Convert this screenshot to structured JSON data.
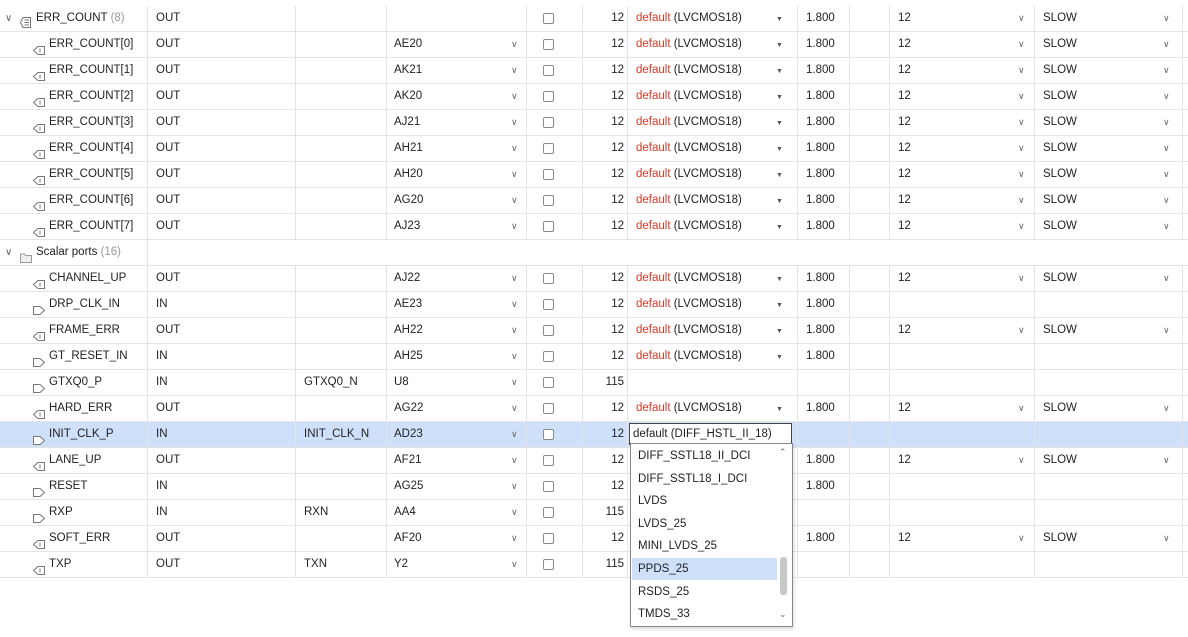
{
  "group1": {
    "label": "ERR_COUNT",
    "count": "(8)",
    "direction": "OUT",
    "bank": "12",
    "std_default": "default",
    "std_rest": " (LVCMOS18)",
    "vcco": "1.800",
    "drive": "12",
    "slew": "SLOW"
  },
  "group2": {
    "label": "Scalar ports",
    "count": "(16)"
  },
  "rows": [
    {
      "name": "ERR_COUNT[0]",
      "dir": "OUT",
      "neg": "",
      "pkg": "AE20",
      "bank": "12",
      "std_default": "default",
      "std_rest": " (LVCMOS18)",
      "vcco": "1.800",
      "drive": "12",
      "slew": "SLOW"
    },
    {
      "name": "ERR_COUNT[1]",
      "dir": "OUT",
      "neg": "",
      "pkg": "AK21",
      "bank": "12",
      "std_default": "default",
      "std_rest": " (LVCMOS18)",
      "vcco": "1.800",
      "drive": "12",
      "slew": "SLOW"
    },
    {
      "name": "ERR_COUNT[2]",
      "dir": "OUT",
      "neg": "",
      "pkg": "AK20",
      "bank": "12",
      "std_default": "default",
      "std_rest": " (LVCMOS18)",
      "vcco": "1.800",
      "drive": "12",
      "slew": "SLOW"
    },
    {
      "name": "ERR_COUNT[3]",
      "dir": "OUT",
      "neg": "",
      "pkg": "AJ21",
      "bank": "12",
      "std_default": "default",
      "std_rest": " (LVCMOS18)",
      "vcco": "1.800",
      "drive": "12",
      "slew": "SLOW"
    },
    {
      "name": "ERR_COUNT[4]",
      "dir": "OUT",
      "neg": "",
      "pkg": "AH21",
      "bank": "12",
      "std_default": "default",
      "std_rest": " (LVCMOS18)",
      "vcco": "1.800",
      "drive": "12",
      "slew": "SLOW"
    },
    {
      "name": "ERR_COUNT[5]",
      "dir": "OUT",
      "neg": "",
      "pkg": "AH20",
      "bank": "12",
      "std_default": "default",
      "std_rest": " (LVCMOS18)",
      "vcco": "1.800",
      "drive": "12",
      "slew": "SLOW"
    },
    {
      "name": "ERR_COUNT[6]",
      "dir": "OUT",
      "neg": "",
      "pkg": "AG20",
      "bank": "12",
      "std_default": "default",
      "std_rest": " (LVCMOS18)",
      "vcco": "1.800",
      "drive": "12",
      "slew": "SLOW"
    },
    {
      "name": "ERR_COUNT[7]",
      "dir": "OUT",
      "neg": "",
      "pkg": "AJ23",
      "bank": "12",
      "std_default": "default",
      "std_rest": " (LVCMOS18)",
      "vcco": "1.800",
      "drive": "12",
      "slew": "SLOW"
    },
    {
      "name": "CHANNEL_UP",
      "dir": "OUT",
      "neg": "",
      "pkg": "AJ22",
      "bank": "12",
      "std_default": "default",
      "std_rest": " (LVCMOS18)",
      "vcco": "1.800",
      "drive": "12",
      "slew": "SLOW"
    },
    {
      "name": "DRP_CLK_IN",
      "dir": "IN",
      "neg": "",
      "pkg": "AE23",
      "bank": "12",
      "std_default": "default",
      "std_rest": " (LVCMOS18)",
      "vcco": "1.800",
      "drive": "",
      "slew": ""
    },
    {
      "name": "FRAME_ERR",
      "dir": "OUT",
      "neg": "",
      "pkg": "AH22",
      "bank": "12",
      "std_default": "default",
      "std_rest": " (LVCMOS18)",
      "vcco": "1.800",
      "drive": "12",
      "slew": "SLOW"
    },
    {
      "name": "GT_RESET_IN",
      "dir": "IN",
      "neg": "",
      "pkg": "AH25",
      "bank": "12",
      "std_default": "default",
      "std_rest": " (LVCMOS18)",
      "vcco": "1.800",
      "drive": "",
      "slew": ""
    },
    {
      "name": "GTXQ0_P",
      "dir": "IN",
      "neg": "GTXQ0_N",
      "pkg": "U8",
      "bank": "115",
      "std_default": "",
      "std_rest": "",
      "vcco": "",
      "drive": "",
      "slew": ""
    },
    {
      "name": "HARD_ERR",
      "dir": "OUT",
      "neg": "",
      "pkg": "AG22",
      "bank": "12",
      "std_default": "default",
      "std_rest": " (LVCMOS18)",
      "vcco": "1.800",
      "drive": "12",
      "slew": "SLOW"
    },
    {
      "name": "INIT_CLK_P",
      "dir": "IN",
      "neg": "INIT_CLK_N",
      "pkg": "AD23",
      "bank": "12",
      "std_default": "",
      "std_rest": "",
      "vcco": "",
      "drive": "",
      "slew": ""
    },
    {
      "name": "LANE_UP",
      "dir": "OUT",
      "neg": "",
      "pkg": "AF21",
      "bank": "12",
      "std_default": "",
      "std_rest": "",
      "vcco": "1.800",
      "drive": "12",
      "slew": "SLOW"
    },
    {
      "name": "RESET",
      "dir": "IN",
      "neg": "",
      "pkg": "AG25",
      "bank": "12",
      "std_default": "",
      "std_rest": "",
      "vcco": "1.800",
      "drive": "",
      "slew": ""
    },
    {
      "name": "RXP",
      "dir": "IN",
      "neg": "RXN",
      "pkg": "AA4",
      "bank": "115",
      "std_default": "",
      "std_rest": "",
      "vcco": "",
      "drive": "",
      "slew": ""
    },
    {
      "name": "SOFT_ERR",
      "dir": "OUT",
      "neg": "",
      "pkg": "AF20",
      "bank": "12",
      "std_default": "",
      "std_rest": "",
      "vcco": "1.800",
      "drive": "12",
      "slew": "SLOW"
    },
    {
      "name": "TXP",
      "dir": "OUT",
      "neg": "TXN",
      "pkg": "Y2",
      "bank": "115",
      "std_default": "",
      "std_rest": "",
      "vcco": "",
      "drive": "",
      "slew": ""
    }
  ],
  "editor": {
    "value": "default (DIFF_HSTL_II_18)",
    "options": [
      "DIFF_SSTL18_II_DCI",
      "DIFF_SSTL18_I_DCI",
      "LVDS",
      "LVDS_25",
      "MINI_LVDS_25",
      "PPDS_25",
      "RSDS_25",
      "TMDS_33"
    ],
    "highlighted": "PPDS_25"
  },
  "colors": {
    "default_text": "#d43a2a",
    "selection": "#cfe0fb"
  },
  "icons": {
    "output_port": "output-port-icon",
    "input_port": "input-port-icon",
    "bus": "bus-icon",
    "folder": "folder-icon"
  }
}
